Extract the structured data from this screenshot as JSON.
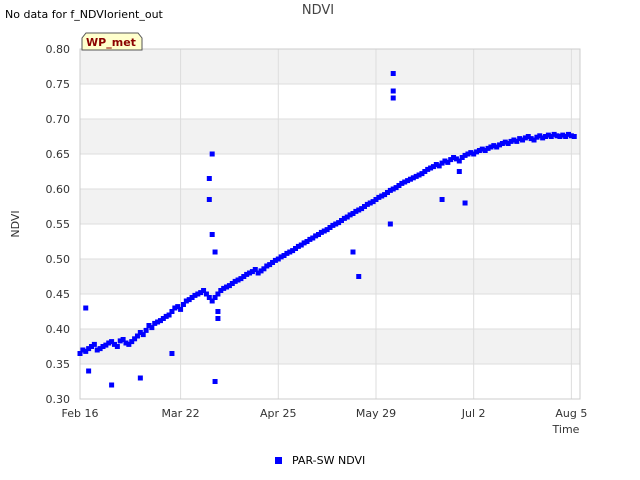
{
  "note": "No data for f_NDVIorient_out",
  "badge": "WP_met",
  "colors": {
    "series": "#0000ff",
    "band": "#f2f2f2",
    "grid": "#dddddd",
    "badge_bg": "#ffffcc"
  },
  "chart_data": {
    "type": "scatter",
    "title": "NDVI",
    "xlabel": "Time",
    "ylabel": "NDVI",
    "ylim": [
      0.3,
      0.8
    ],
    "xlim": [
      "2024-02-16",
      "2024-08-08"
    ],
    "yticks": [
      0.3,
      0.35,
      0.4,
      0.45,
      0.5,
      0.55,
      0.6,
      0.65,
      0.7,
      0.75,
      0.8
    ],
    "yticklabels": [
      "0.30",
      "0.35",
      "0.40",
      "0.45",
      "0.50",
      "0.55",
      "0.60",
      "0.65",
      "0.70",
      "0.75",
      "0.80"
    ],
    "xticks": [
      "2024-02-16",
      "2024-03-22",
      "2024-04-25",
      "2024-05-29",
      "2024-07-02",
      "2024-08-05"
    ],
    "xticklabels": [
      "Feb 16",
      "Mar 22",
      "Apr 25",
      "May 29",
      "Jul 2",
      "Aug 5"
    ],
    "grid": true,
    "legend_position": "bottom-center",
    "series": [
      {
        "name": "PAR-SW NDVI",
        "color": "#0000ff",
        "x": [
          "2024-02-16",
          "2024-02-17",
          "2024-02-18",
          "2024-02-19",
          "2024-02-20",
          "2024-02-21",
          "2024-02-22",
          "2024-02-23",
          "2024-02-24",
          "2024-02-25",
          "2024-02-26",
          "2024-02-27",
          "2024-02-28",
          "2024-02-29",
          "2024-03-01",
          "2024-03-02",
          "2024-03-03",
          "2024-03-04",
          "2024-03-05",
          "2024-03-06",
          "2024-03-07",
          "2024-03-08",
          "2024-03-09",
          "2024-03-10",
          "2024-03-11",
          "2024-03-12",
          "2024-03-13",
          "2024-03-14",
          "2024-03-15",
          "2024-03-16",
          "2024-03-17",
          "2024-03-18",
          "2024-03-19",
          "2024-03-20",
          "2024-03-21",
          "2024-03-22",
          "2024-03-23",
          "2024-03-24",
          "2024-03-25",
          "2024-03-26",
          "2024-03-27",
          "2024-03-28",
          "2024-03-29",
          "2024-03-30",
          "2024-03-31",
          "2024-04-01",
          "2024-04-02",
          "2024-04-03",
          "2024-04-04",
          "2024-04-05",
          "2024-04-06",
          "2024-04-07",
          "2024-04-08",
          "2024-04-09",
          "2024-04-10",
          "2024-04-11",
          "2024-04-12",
          "2024-04-13",
          "2024-04-14",
          "2024-04-15",
          "2024-04-16",
          "2024-04-17",
          "2024-04-18",
          "2024-04-19",
          "2024-04-20",
          "2024-04-21",
          "2024-04-22",
          "2024-04-23",
          "2024-04-24",
          "2024-04-25",
          "2024-04-26",
          "2024-04-27",
          "2024-04-28",
          "2024-04-29",
          "2024-04-30",
          "2024-05-01",
          "2024-05-02",
          "2024-05-03",
          "2024-05-04",
          "2024-05-05",
          "2024-05-06",
          "2024-05-07",
          "2024-05-08",
          "2024-05-09",
          "2024-05-10",
          "2024-05-11",
          "2024-05-12",
          "2024-05-13",
          "2024-05-14",
          "2024-05-15",
          "2024-05-16",
          "2024-05-17",
          "2024-05-18",
          "2024-05-19",
          "2024-05-20",
          "2024-05-21",
          "2024-05-22",
          "2024-05-23",
          "2024-05-24",
          "2024-05-25",
          "2024-05-26",
          "2024-05-27",
          "2024-05-28",
          "2024-05-29",
          "2024-05-30",
          "2024-05-31",
          "2024-06-01",
          "2024-06-02",
          "2024-06-03",
          "2024-06-04",
          "2024-06-05",
          "2024-06-06",
          "2024-06-07",
          "2024-06-08",
          "2024-06-09",
          "2024-06-10",
          "2024-06-11",
          "2024-06-12",
          "2024-06-13",
          "2024-06-14",
          "2024-06-15",
          "2024-06-16",
          "2024-06-17",
          "2024-06-18",
          "2024-06-19",
          "2024-06-20",
          "2024-06-21",
          "2024-06-22",
          "2024-06-23",
          "2024-06-24",
          "2024-06-25",
          "2024-06-26",
          "2024-06-27",
          "2024-06-28",
          "2024-06-29",
          "2024-06-30",
          "2024-07-01",
          "2024-07-02",
          "2024-07-03",
          "2024-07-04",
          "2024-07-05",
          "2024-07-06",
          "2024-07-07",
          "2024-07-08",
          "2024-07-09",
          "2024-07-10",
          "2024-07-11",
          "2024-07-12",
          "2024-07-13",
          "2024-07-14",
          "2024-07-15",
          "2024-07-16",
          "2024-07-17",
          "2024-07-18",
          "2024-07-19",
          "2024-07-20",
          "2024-07-21",
          "2024-07-22",
          "2024-07-23",
          "2024-07-24",
          "2024-07-25",
          "2024-07-26",
          "2024-07-27",
          "2024-07-28",
          "2024-07-29",
          "2024-07-30",
          "2024-07-31",
          "2024-08-01",
          "2024-08-02",
          "2024-08-03",
          "2024-08-04",
          "2024-08-05",
          "2024-08-06",
          "2024-04-01",
          "2024-04-01",
          "2024-04-02",
          "2024-04-02",
          "2024-04-03",
          "2024-04-04",
          "2024-04-04",
          "2024-06-04",
          "2024-06-04",
          "2024-06-04",
          "2024-02-18",
          "2024-02-19",
          "2024-02-27",
          "2024-03-08",
          "2024-03-19",
          "2024-04-03",
          "2024-05-21",
          "2024-05-23",
          "2024-06-03",
          "2024-06-21",
          "2024-06-27",
          "2024-06-29"
        ],
        "y": [
          0.365,
          0.37,
          0.368,
          0.372,
          0.375,
          0.378,
          0.37,
          0.372,
          0.375,
          0.377,
          0.38,
          0.382,
          0.378,
          0.375,
          0.383,
          0.385,
          0.38,
          0.378,
          0.382,
          0.386,
          0.39,
          0.395,
          0.392,
          0.398,
          0.405,
          0.402,
          0.408,
          0.41,
          0.412,
          0.415,
          0.418,
          0.42,
          0.425,
          0.43,
          0.432,
          0.428,
          0.435,
          0.44,
          0.442,
          0.445,
          0.448,
          0.45,
          0.452,
          0.455,
          0.45,
          0.445,
          0.44,
          0.445,
          0.45,
          0.455,
          0.458,
          0.46,
          0.462,
          0.465,
          0.468,
          0.47,
          0.472,
          0.475,
          0.478,
          0.48,
          0.482,
          0.485,
          0.48,
          0.483,
          0.486,
          0.49,
          0.492,
          0.495,
          0.498,
          0.5,
          0.503,
          0.505,
          0.508,
          0.51,
          0.512,
          0.515,
          0.518,
          0.52,
          0.523,
          0.525,
          0.528,
          0.53,
          0.533,
          0.535,
          0.538,
          0.54,
          0.542,
          0.545,
          0.548,
          0.55,
          0.552,
          0.555,
          0.558,
          0.56,
          0.563,
          0.565,
          0.568,
          0.57,
          0.572,
          0.575,
          0.578,
          0.58,
          0.582,
          0.585,
          0.588,
          0.59,
          0.592,
          0.595,
          0.598,
          0.6,
          0.602,
          0.605,
          0.608,
          0.61,
          0.612,
          0.614,
          0.616,
          0.618,
          0.62,
          0.622,
          0.625,
          0.628,
          0.63,
          0.632,
          0.635,
          0.633,
          0.637,
          0.64,
          0.638,
          0.642,
          0.645,
          0.643,
          0.64,
          0.645,
          0.648,
          0.65,
          0.652,
          0.65,
          0.653,
          0.655,
          0.657,
          0.655,
          0.658,
          0.66,
          0.662,
          0.66,
          0.663,
          0.665,
          0.667,
          0.665,
          0.668,
          0.67,
          0.668,
          0.672,
          0.67,
          0.673,
          0.675,
          0.672,
          0.67,
          0.674,
          0.676,
          0.673,
          0.675,
          0.677,
          0.675,
          0.678,
          0.676,
          0.675,
          0.677,
          0.675,
          0.678,
          0.676,
          0.675,
          0.585,
          0.615,
          0.65,
          0.535,
          0.51,
          0.425,
          0.415,
          0.765,
          0.74,
          0.73,
          0.43,
          0.34,
          0.32,
          0.33,
          0.365,
          0.325,
          0.51,
          0.475,
          0.55,
          0.585,
          0.625,
          0.58
        ]
      }
    ]
  }
}
